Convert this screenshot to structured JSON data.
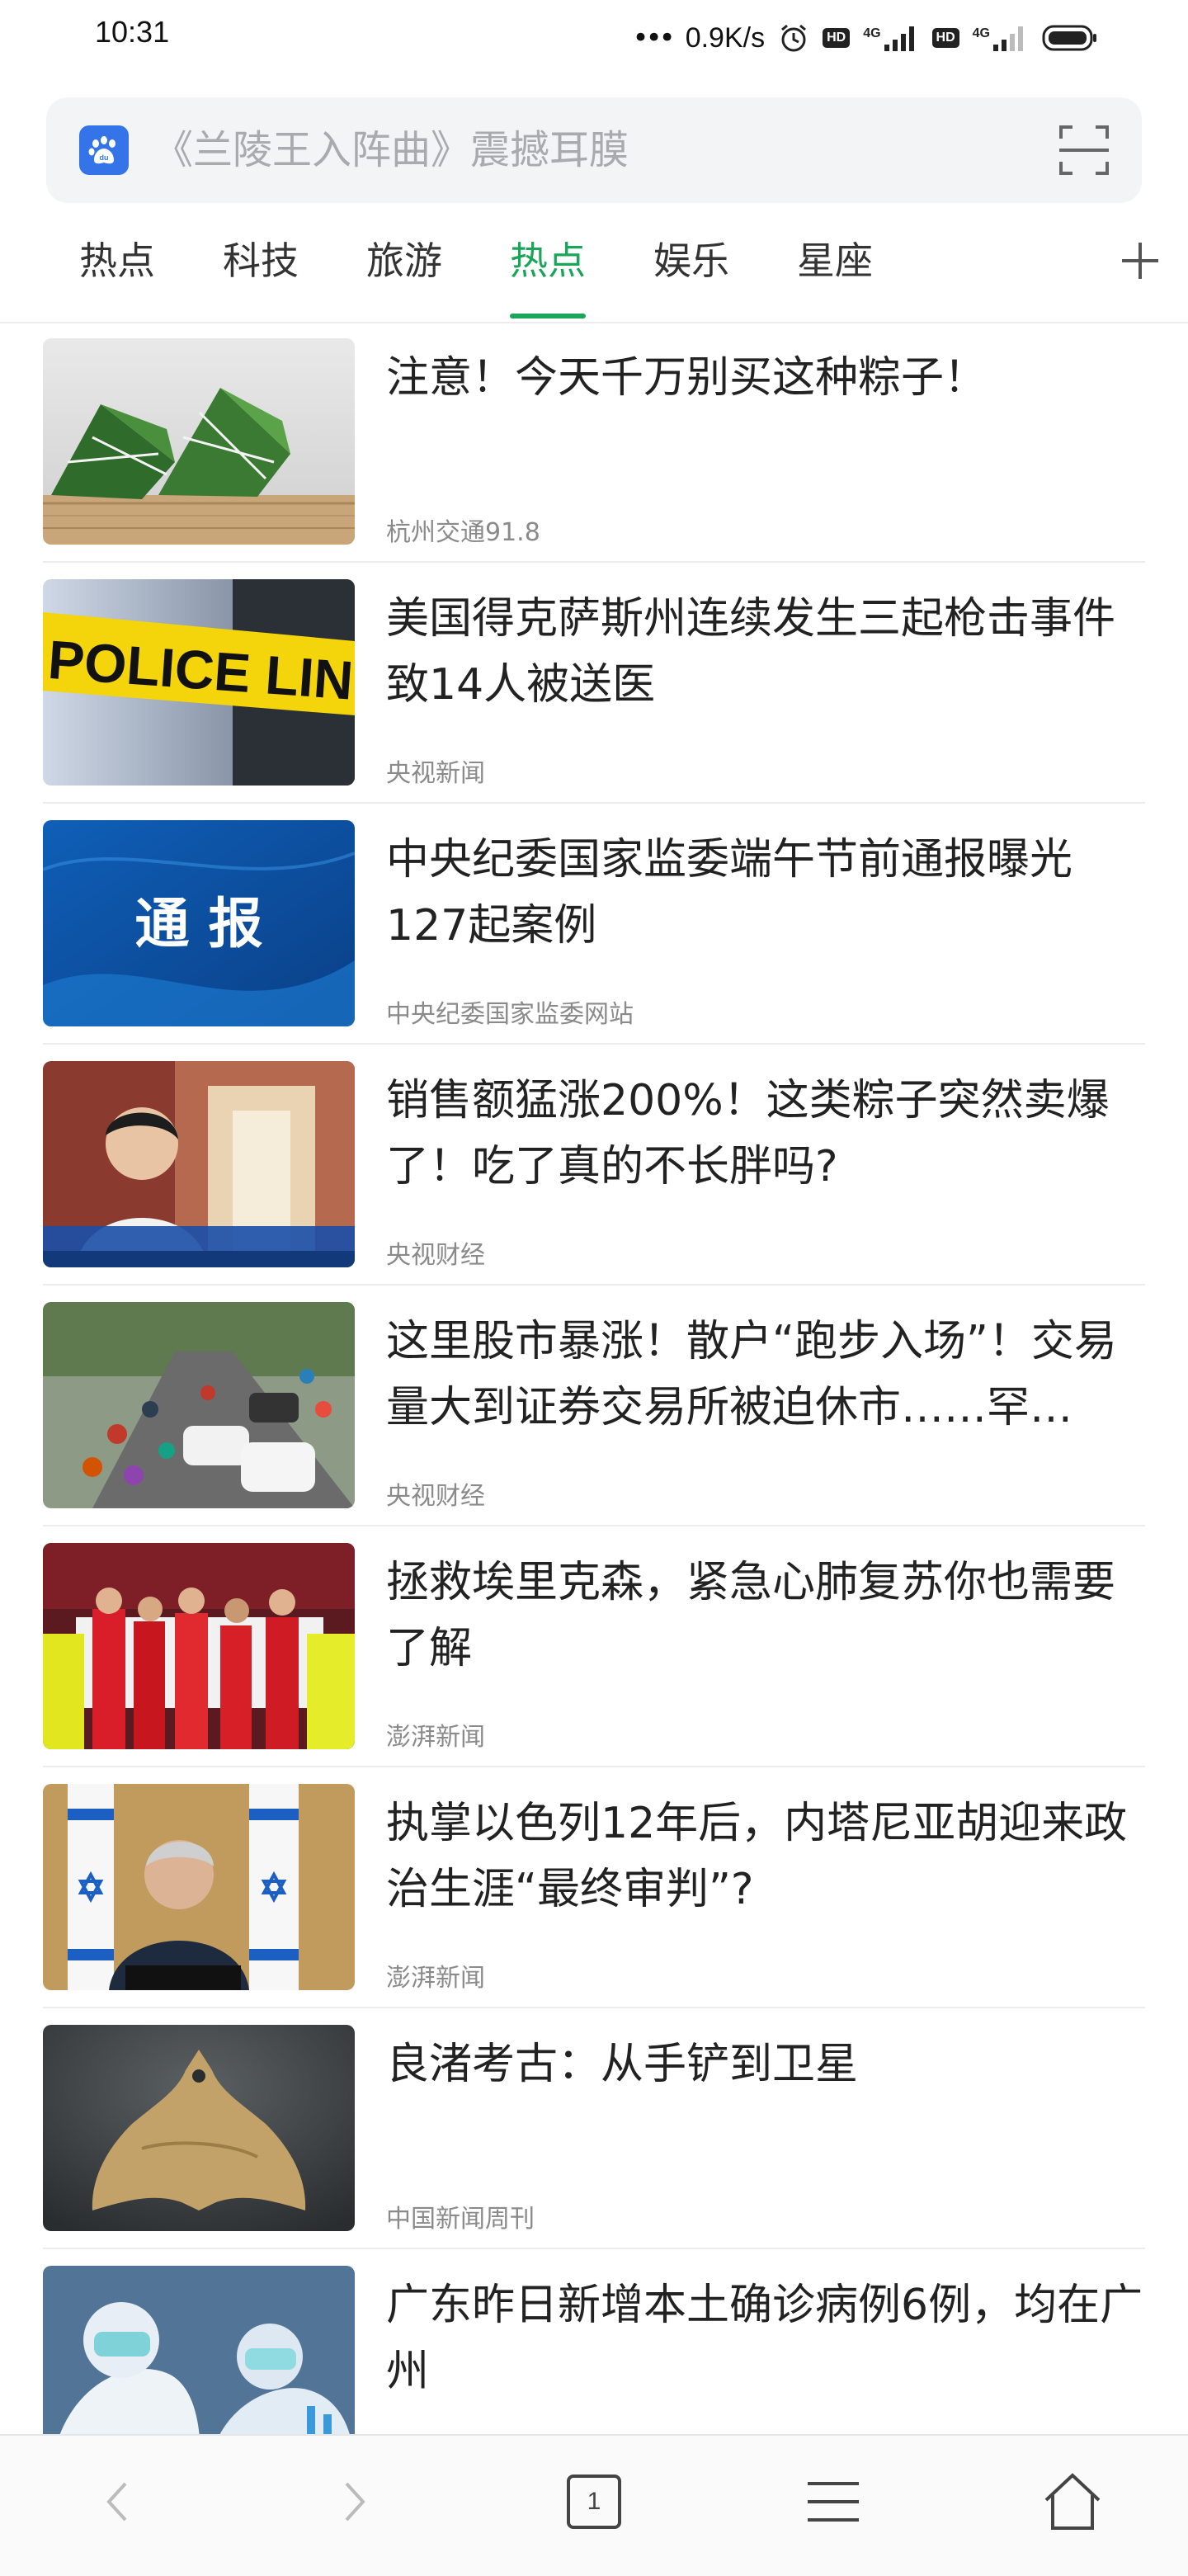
{
  "status_bar": {
    "time": "10:31",
    "net_speed": "0.9K/s",
    "network_1": "4G",
    "network_2": "4G",
    "hd_label": "HD",
    "icons": [
      "alarm-icon",
      "hd-icon",
      "signal-icon",
      "hd-icon",
      "signal-icon",
      "battery-icon"
    ]
  },
  "search": {
    "placeholder": "《兰陵王入阵曲》震撼耳膜",
    "logo": "baidu-paw-icon",
    "scan_icon": "scan-icon"
  },
  "tabs": [
    {
      "label": "热点",
      "active": false
    },
    {
      "label": "科技",
      "active": false
    },
    {
      "label": "旅游",
      "active": false
    },
    {
      "label": "热点",
      "active": true
    },
    {
      "label": "娱乐",
      "active": false
    },
    {
      "label": "星座",
      "active": false
    }
  ],
  "tabs_add_icon": "plus-icon",
  "accent_color": "#1aa55a",
  "feed": [
    {
      "title": "注意！今天千万别买这种粽子！",
      "source": "杭州交通91.8"
    },
    {
      "title": "美国得克萨斯州连续发生三起枪击事件 致14人被送医",
      "source": "央视新闻",
      "thumb_text": "POLICE LINE DO"
    },
    {
      "title": "中央纪委国家监委端午节前通报曝光127起案例",
      "source": "中央纪委国家监委网站",
      "thumb_text": "通 报"
    },
    {
      "title": "销售额猛涨200%！这类粽子突然卖爆了！吃了真的不长胖吗?",
      "source": "央视财经"
    },
    {
      "title": "这里股市暴涨！散户“跑步入场”！交易量大到证券交易所被迫休市……罕…",
      "source": "央视财经"
    },
    {
      "title": "拯救埃里克森，紧急心肺复苏你也需要了解",
      "source": "澎湃新闻"
    },
    {
      "title": "执掌以色列12年后，内塔尼亚胡迎来政治生涯“最终审判”?",
      "source": "澎湃新闻"
    },
    {
      "title": "良渚考古：从手铲到卫星",
      "source": "中国新闻周刊"
    },
    {
      "title": "广东昨日新增本土确诊病例6例，均在广州",
      "source": ""
    }
  ],
  "bottom_nav": {
    "tab_count": "1",
    "icons": [
      "back-icon",
      "forward-icon",
      "tabs-icon",
      "menu-icon",
      "home-icon"
    ]
  }
}
